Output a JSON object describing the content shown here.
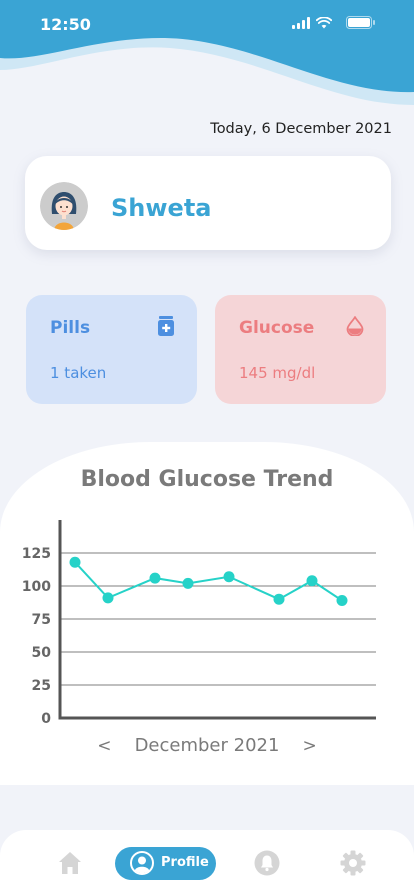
{
  "status_bar": {
    "time": "12:50"
  },
  "header": {
    "date": "Today, 6 December 2021"
  },
  "profile": {
    "name": "Shweta",
    "avatar_icon": "user-avatar-icon"
  },
  "stats": {
    "pills": {
      "title": "Pills",
      "value": "1 taken",
      "icon": "medicine-bottle-icon",
      "color": "#4d8fe0"
    },
    "glucose": {
      "title": "Glucose",
      "value": "145 mg/dl",
      "icon": "blood-drop-icon",
      "color": "#ec7d80"
    }
  },
  "chart": {
    "month_label": "December 2021",
    "prev_label": "<",
    "next_label": ">"
  },
  "chart_data": {
    "type": "line",
    "title": "Blood Glucose Trend",
    "xlabel": "",
    "ylabel": "",
    "y_ticks": [
      0,
      25,
      50,
      75,
      100,
      125
    ],
    "ylim": [
      0,
      150
    ],
    "grid": true,
    "series": [
      {
        "values": [
          118,
          91,
          106,
          102,
          107,
          90,
          104,
          89
        ],
        "color": "#26d2c8"
      }
    ]
  },
  "bottom_nav": {
    "items": [
      {
        "icon": "home-icon"
      },
      {
        "label": "Profile",
        "icon": "profile-icon",
        "active": true
      },
      {
        "icon": "bell-icon"
      },
      {
        "icon": "gear-icon"
      }
    ],
    "accent": "#3aa4d4"
  }
}
